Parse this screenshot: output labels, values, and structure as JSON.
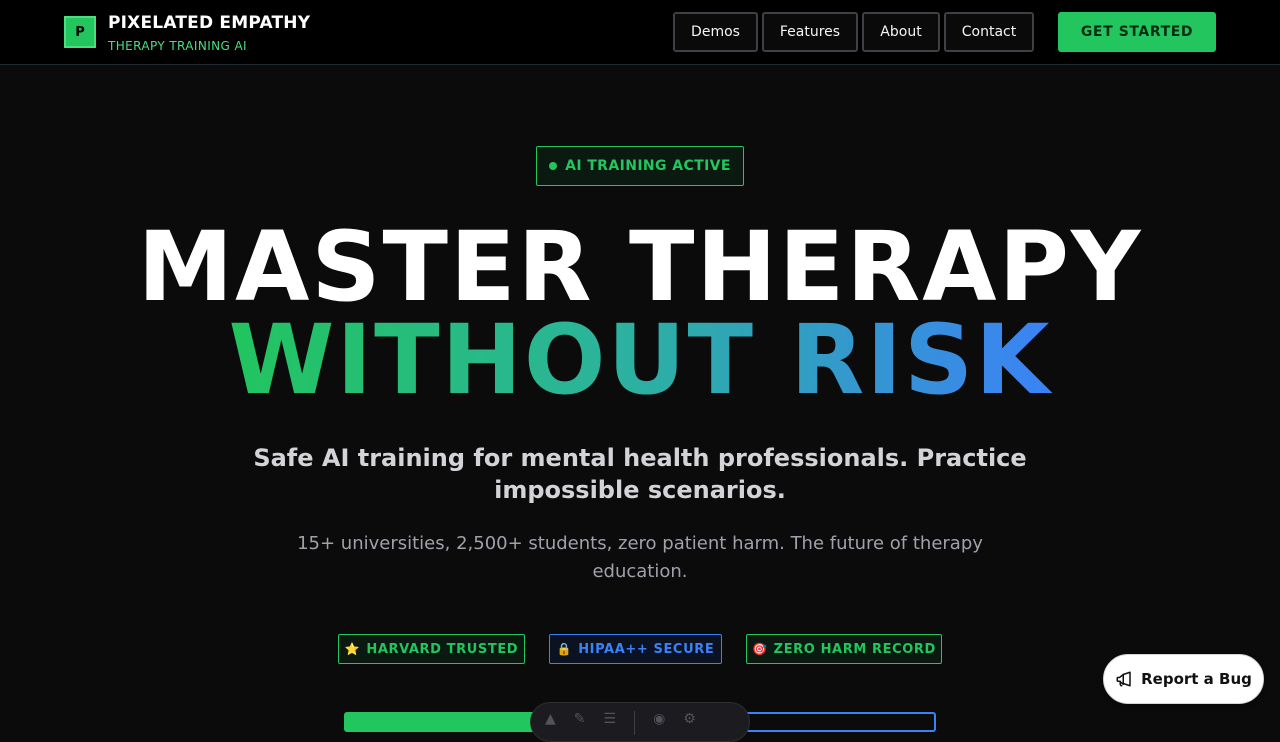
{
  "header": {
    "logo_letter": "P",
    "brand_name": "PIXELATED EMPATHY",
    "brand_tagline": "THERAPY TRAINING AI",
    "nav": {
      "demos": "Demos",
      "features": "Features",
      "about": "About",
      "contact": "Contact"
    },
    "cta_label": "GET STARTED"
  },
  "hero": {
    "status_badge": "AI TRAINING ACTIVE",
    "headline_line1": "MASTER THERAPY",
    "headline_line2": "WITHOUT RISK",
    "subtitle": "Safe AI training for mental health professionals. Practice impossible scenarios.",
    "subtext": "15+ universities, 2,500+ students, zero patient harm. The future of therapy education."
  },
  "trust_badges": {
    "harvard": {
      "icon": "⭐",
      "label": "HARVARD TRUSTED"
    },
    "hipaa": {
      "icon": "🔒",
      "label": "HIPAA++ SECURE"
    },
    "zero_harm": {
      "icon": "🎯",
      "label": "ZERO HARM RECORD"
    }
  },
  "report_bug_label": "Report a Bug",
  "colors": {
    "accent_green": "#22c55e",
    "accent_blue": "#3b82f6",
    "background": "#0b0b0c"
  }
}
